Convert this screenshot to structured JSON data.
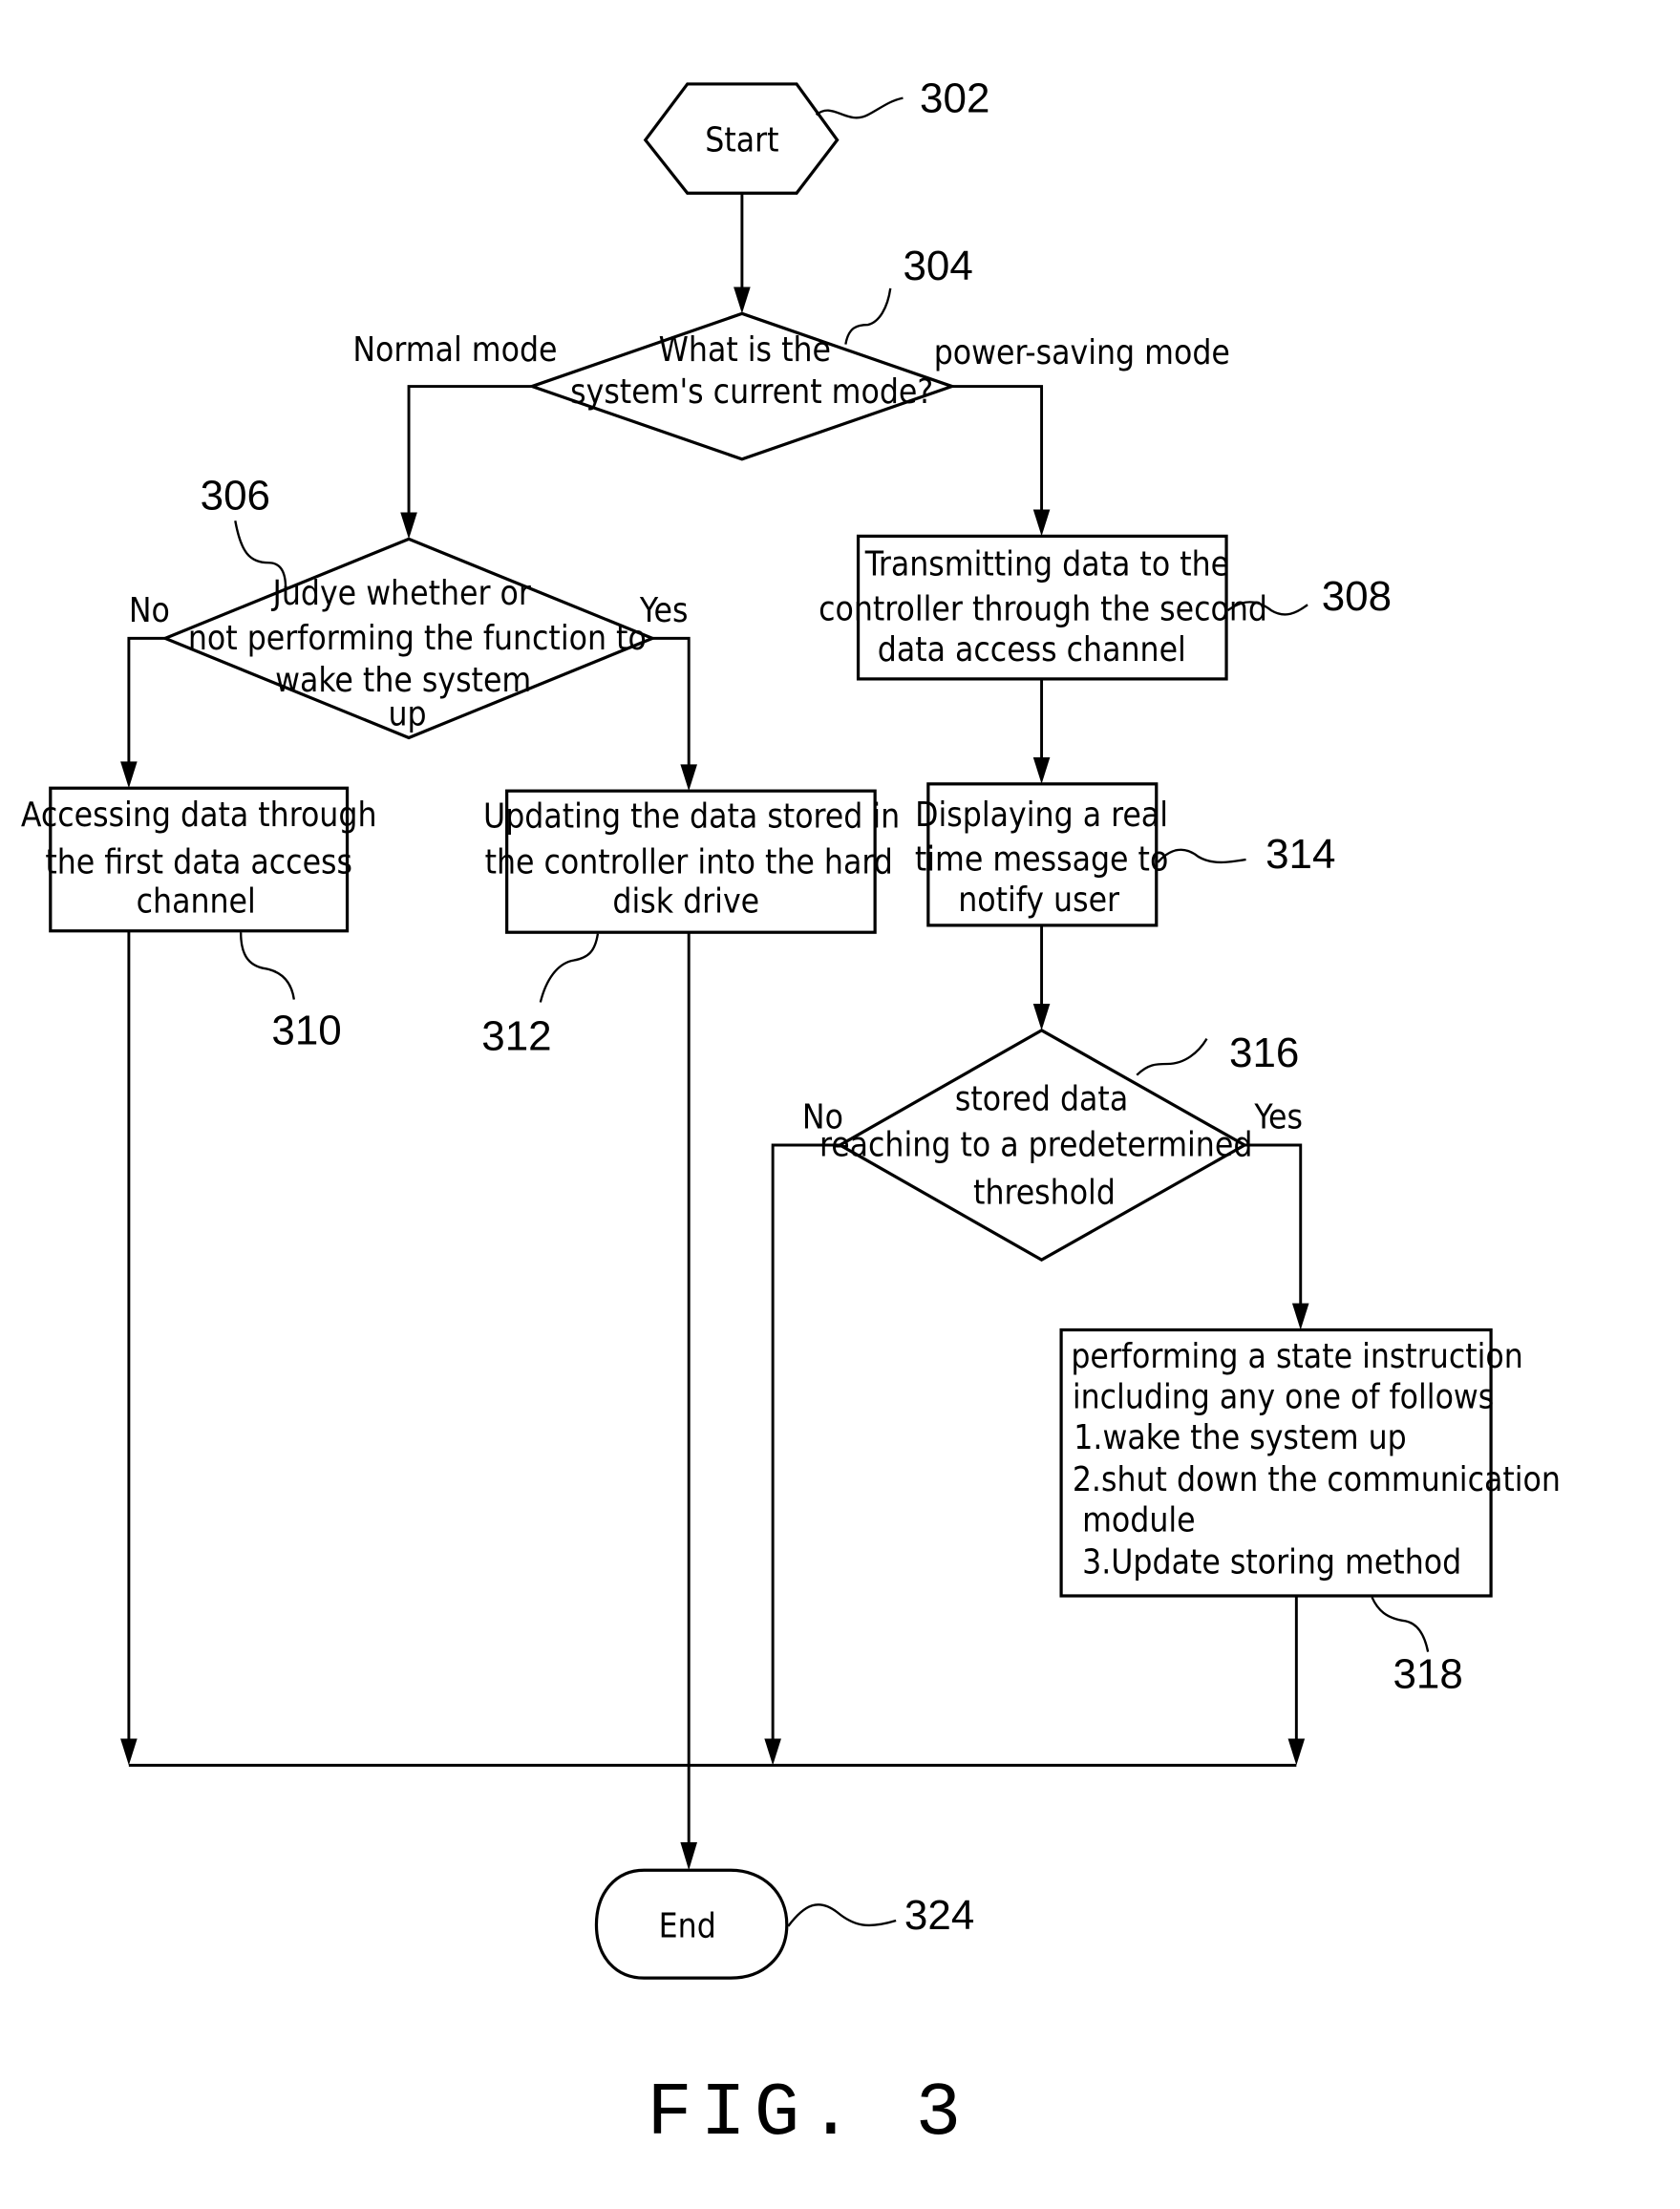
{
  "figure": {
    "caption": "FIG. 3",
    "nodes": {
      "start": {
        "ref": "302",
        "text": "Start"
      },
      "mode_decision": {
        "ref": "304",
        "lines": [
          "What is the",
          "system's current mode?"
        ]
      },
      "wake_decision": {
        "ref": "306",
        "lines": [
          "Judye whether or",
          "not performing the function to",
          "wake the system",
          "up"
        ]
      },
      "transmit": {
        "ref": "308",
        "lines": [
          "Transmitting data to the",
          "controller through the second",
          "data access channel"
        ]
      },
      "access_first": {
        "ref": "310",
        "lines": [
          "Accessing data through",
          "the first data access",
          "channel"
        ]
      },
      "update_hdd": {
        "ref": "312",
        "lines": [
          "Updating the data stored in",
          "the controller into the hard",
          "disk drive"
        ]
      },
      "display_msg": {
        "ref": "314",
        "lines": [
          "Displaying a real",
          "time message to",
          "notify user"
        ]
      },
      "threshold_decision": {
        "ref": "316",
        "lines": [
          "stored data",
          "reaching to a predetermined",
          "threshold"
        ]
      },
      "state_instruction": {
        "ref": "318",
        "lines": [
          "performing a state instruction",
          "including any one of follows",
          "1.wake the system up",
          "2.shut down the communication",
          "module",
          "3.Update storing method"
        ]
      },
      "end": {
        "ref": "324",
        "text": "End"
      }
    },
    "edge_labels": {
      "normal_mode": "Normal mode",
      "power_saving_mode": "power-saving mode",
      "wake_no": "No",
      "wake_yes": "Yes",
      "threshold_no": "No",
      "threshold_yes": "Yes"
    }
  }
}
